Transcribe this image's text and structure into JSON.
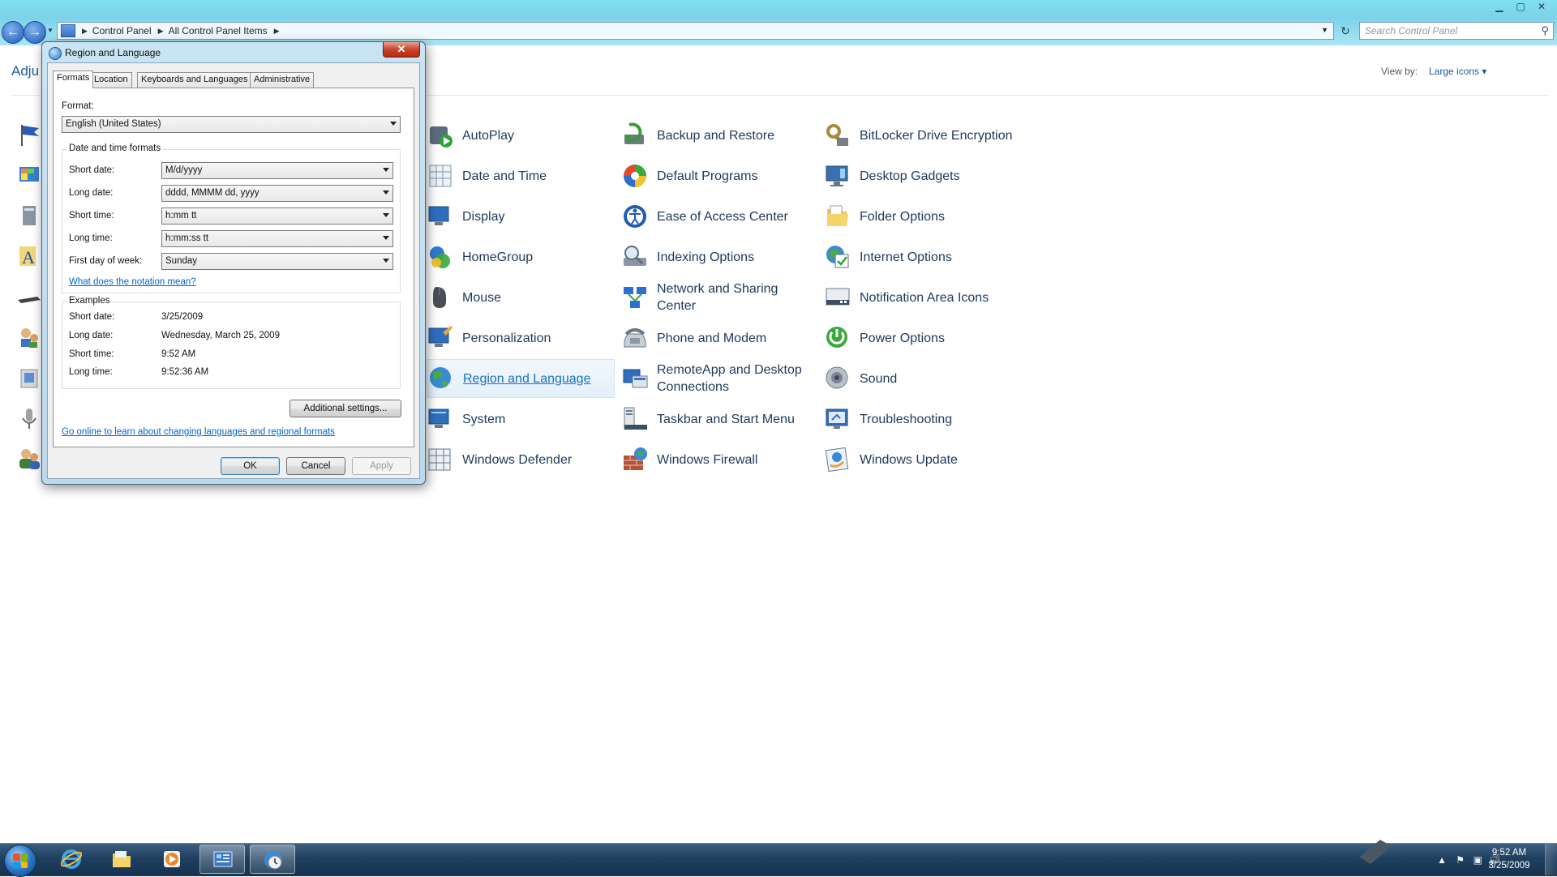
{
  "window": {
    "controls": {
      "minimize": "▁",
      "maximize": "▢",
      "close": "✕"
    },
    "breadcrumb": [
      "Control Panel",
      "All Control Panel Items"
    ],
    "search_placeholder": "Search Control Panel"
  },
  "main": {
    "heading": "Adju",
    "view_by_label": "View by:",
    "view_by_value": "Large icons ▾",
    "items": [
      {
        "label": "AutoPlay",
        "icon": "autoplay-icon"
      },
      {
        "label": "Backup and Restore",
        "icon": "backup-icon"
      },
      {
        "label": "BitLocker Drive Encryption",
        "icon": "bitlocker-icon"
      },
      {
        "label": "Date and Time",
        "icon": "clock-icon"
      },
      {
        "label": "Default Programs",
        "icon": "default-programs-icon"
      },
      {
        "label": "Desktop Gadgets",
        "icon": "gadgets-icon"
      },
      {
        "label": "Display",
        "icon": "display-icon"
      },
      {
        "label": "Ease of Access Center",
        "icon": "ease-of-access-icon"
      },
      {
        "label": "Folder Options",
        "icon": "folder-icon"
      },
      {
        "label": "HomeGroup",
        "icon": "homegroup-icon"
      },
      {
        "label": "Indexing Options",
        "icon": "indexing-icon"
      },
      {
        "label": "Internet Options",
        "icon": "internet-icon"
      },
      {
        "label": "Mouse",
        "icon": "mouse-icon"
      },
      {
        "label": "Network and Sharing Center",
        "icon": "network-icon"
      },
      {
        "label": "Notification Area Icons",
        "icon": "notification-icon"
      },
      {
        "label": "Personalization",
        "icon": "personalization-icon"
      },
      {
        "label": "Phone and Modem",
        "icon": "phone-icon"
      },
      {
        "label": "Power Options",
        "icon": "power-icon"
      },
      {
        "label": "Region and Language",
        "icon": "globe-icon"
      },
      {
        "label": "RemoteApp and Desktop Connections",
        "icon": "remoteapp-icon"
      },
      {
        "label": "Sound",
        "icon": "sound-icon"
      },
      {
        "label": "System",
        "icon": "system-icon"
      },
      {
        "label": "Taskbar and Start Menu",
        "icon": "taskbar-icon"
      },
      {
        "label": "Troubleshooting",
        "icon": "troubleshooting-icon"
      },
      {
        "label": "Windows Defender",
        "icon": "defender-icon"
      },
      {
        "label": "Windows Firewall",
        "icon": "firewall-icon"
      },
      {
        "label": "Windows Update",
        "icon": "update-icon"
      }
    ],
    "selected_item": "Region and Language"
  },
  "dialog": {
    "title": "Region and Language",
    "close": "✕",
    "tabs": [
      "Formats",
      "Location",
      "Keyboards and Languages",
      "Administrative"
    ],
    "active_tab": "Formats",
    "format_label": "Format:",
    "format_value": "English (United States)",
    "dt_group_title": "Date and time formats",
    "fields": [
      {
        "label": "Short date:",
        "value": "M/d/yyyy"
      },
      {
        "label": "Long date:",
        "value": "dddd, MMMM dd, yyyy"
      },
      {
        "label": "Short time:",
        "value": "h:mm tt"
      },
      {
        "label": "Long time:",
        "value": "h:mm:ss tt"
      },
      {
        "label": "First day of week:",
        "value": "Sunday"
      }
    ],
    "notation_link": "What does the notation mean?",
    "examples_title": "Examples",
    "examples": [
      {
        "label": "Short date:",
        "value": "3/25/2009"
      },
      {
        "label": "Long date:",
        "value": "Wednesday, March 25, 2009"
      },
      {
        "label": "Short time:",
        "value": "9:52 AM"
      },
      {
        "label": "Long time:",
        "value": "9:52:36 AM"
      }
    ],
    "additional_settings": "Additional settings...",
    "online_link": "Go online to learn about changing languages and regional formats",
    "ok": "OK",
    "cancel": "Cancel",
    "apply": "Apply"
  },
  "taskbar": {
    "clock_time": "9:52 AM",
    "clock_date": "3/25/2009",
    "tray_icons": [
      "▲",
      "⚑",
      "▣",
      "🔊"
    ]
  },
  "colors": {
    "accent": "#1e5a9c",
    "link": "#0066cc",
    "taskbar": "#1f3f5f",
    "title_glass": "#c9e4f3"
  }
}
